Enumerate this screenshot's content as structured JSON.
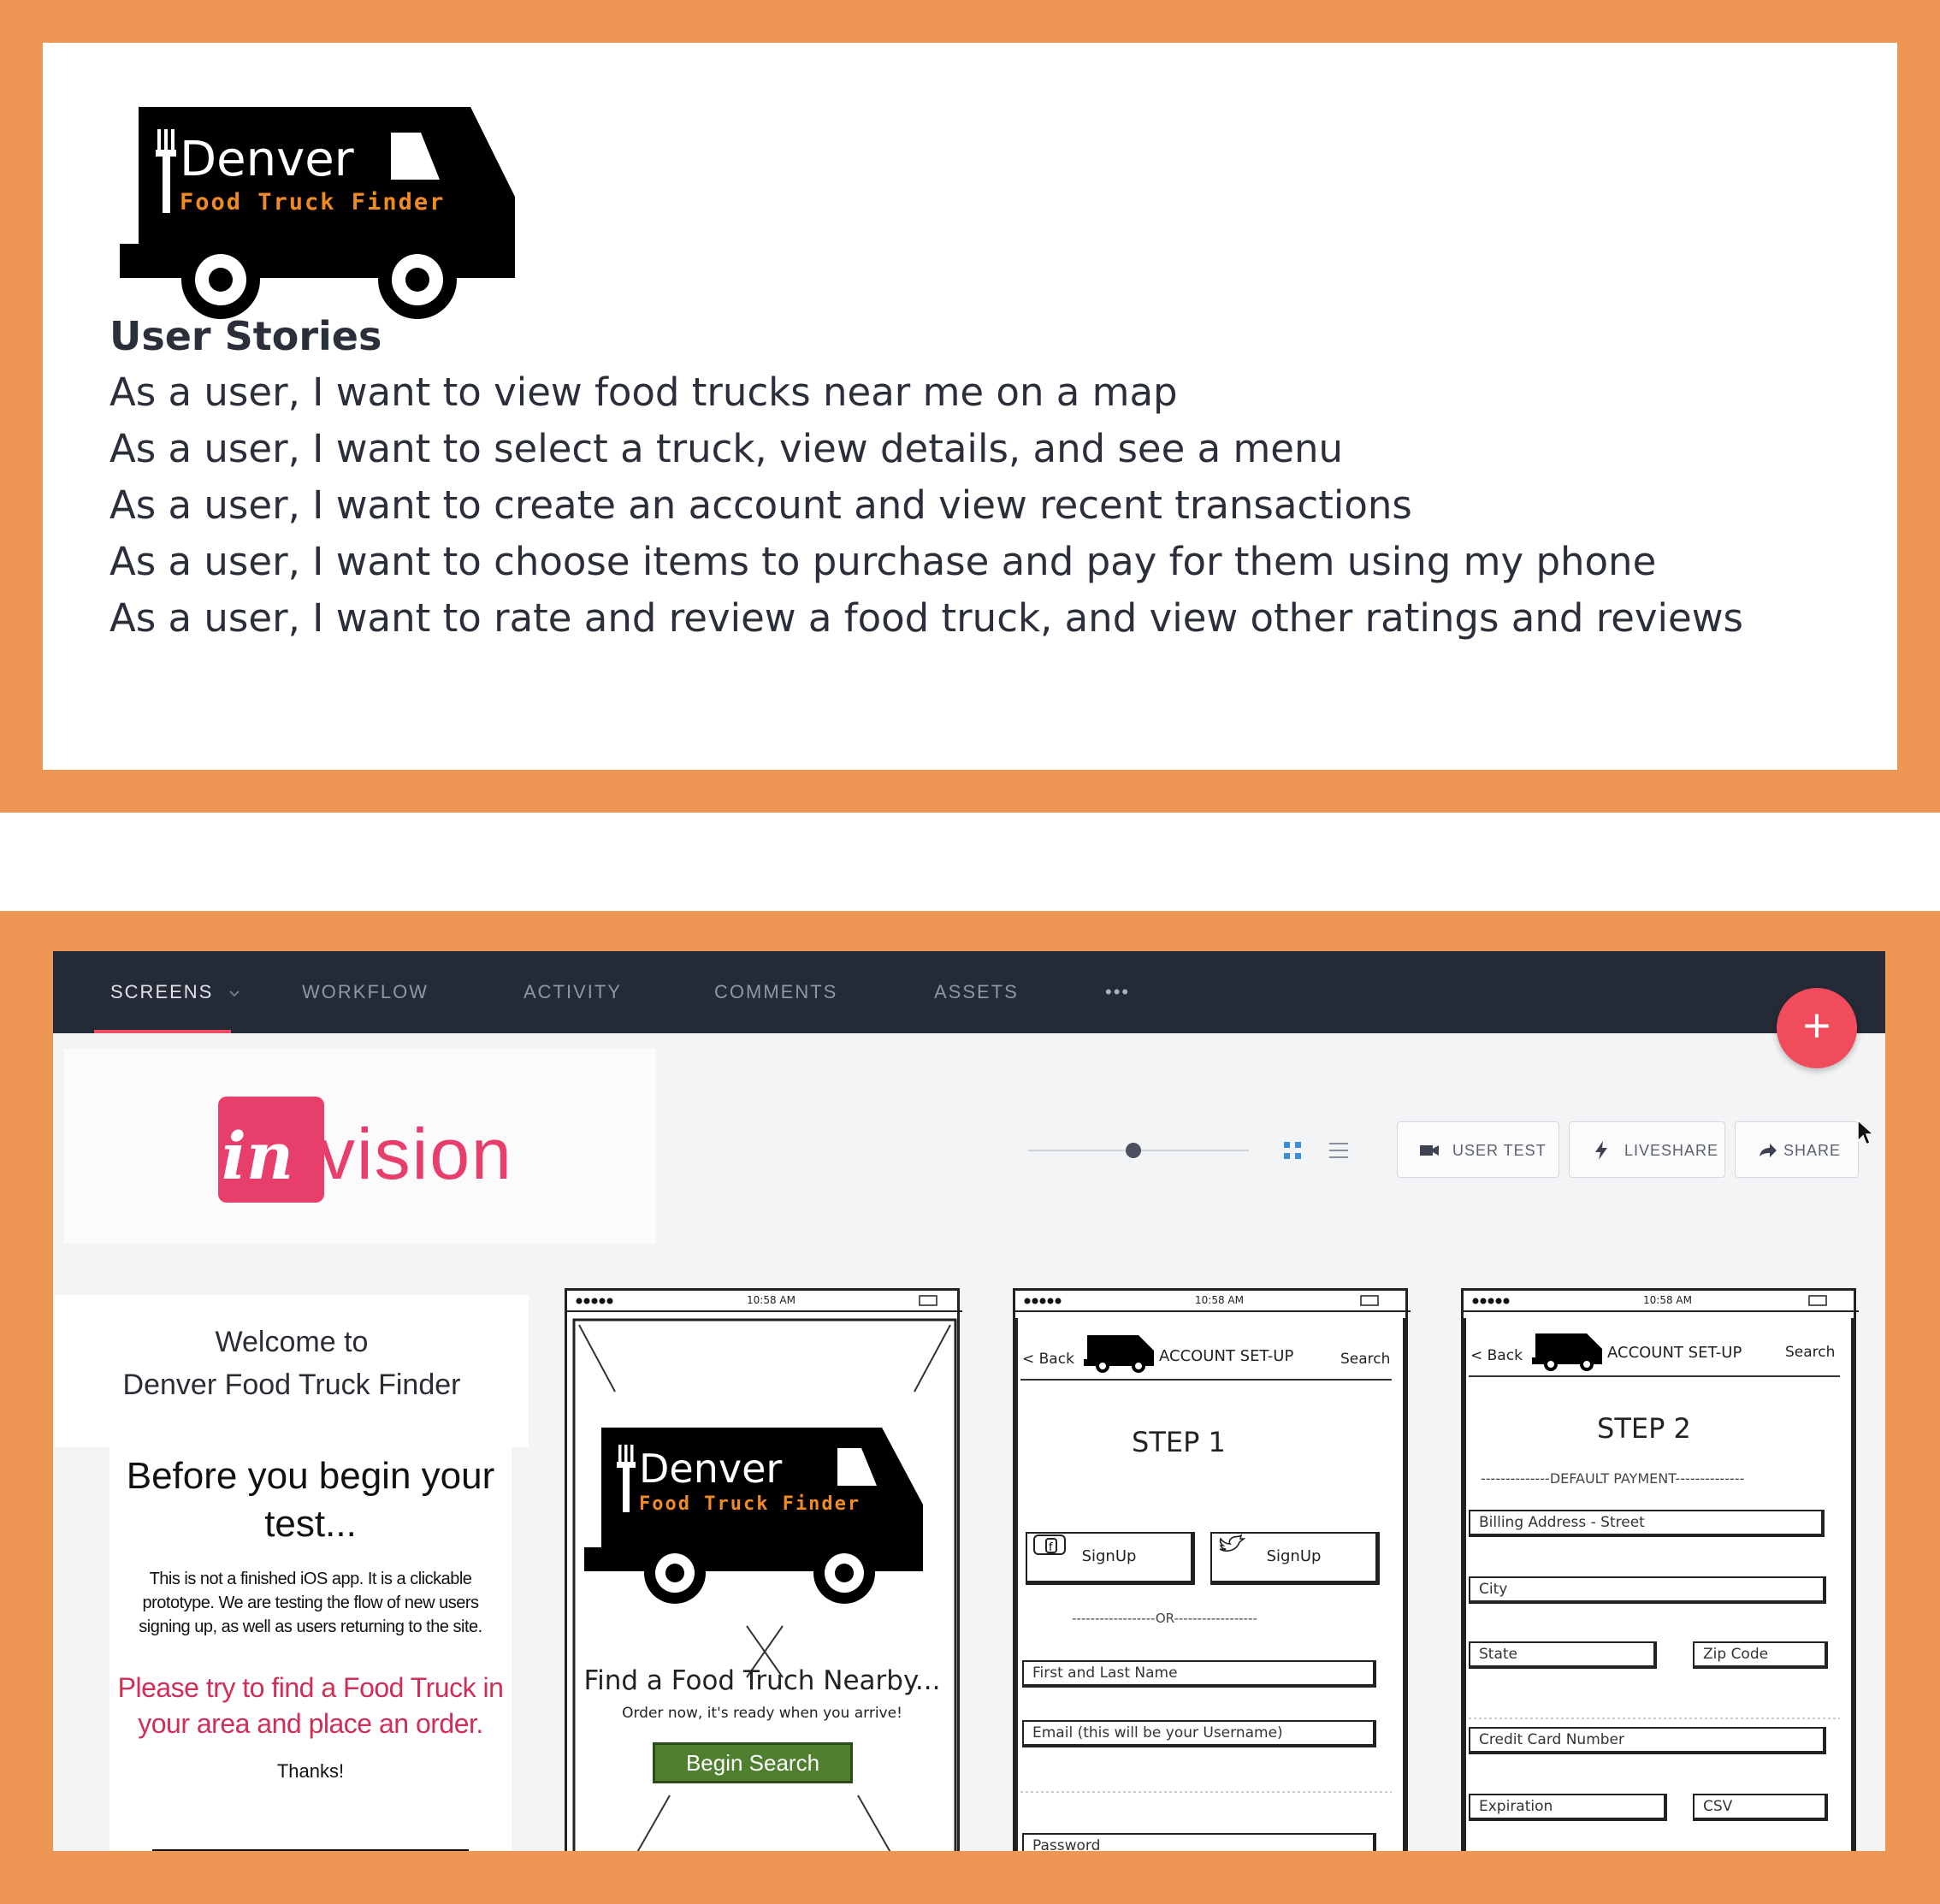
{
  "logo": {
    "line1": "Denver",
    "line2": "Food Truck Finder"
  },
  "user_stories": {
    "title": "User Stories",
    "items": [
      "As a user, I want to view food trucks near me on a map",
      "As a user, I want to select a truck, view details, and see a menu",
      "As a user, I want to create an account and view recent transactions",
      "As a user, I want to choose items to purchase and pay for them using my phone",
      "As a user, I want to rate and review a food truck, and view other ratings and reviews"
    ]
  },
  "nav": {
    "items": [
      "SCREENS",
      "WORKFLOW",
      "ACTIVITY",
      "COMMENTS",
      "ASSETS"
    ],
    "more": "•••",
    "active_index": 0
  },
  "fab_label": "+",
  "invision_logo": "invision",
  "toolbar": {
    "user_test": "USER TEST",
    "liveshare": "LIVESHARE",
    "share": "SHARE"
  },
  "welcome": {
    "line1": "Welcome to",
    "line2": "Denver Food Truck Finder",
    "title": "Before you begin your test...",
    "body": "This is not a finished iOS app. It is a clickable prototype. We are testing the flow of new users signing up, as well as users returning to the site.",
    "call_to_action": "Please try to find a Food Truck in your area and place an order.",
    "thanks": "Thanks!"
  },
  "phone_status": {
    "time": "10:58 AM"
  },
  "screen_home": {
    "headline": "Find a Food Truch Nearby...",
    "subtext": "Order now, it's ready when you arrive!",
    "button": "Begin Search"
  },
  "screen_step1": {
    "back": "< Back",
    "title": "ACCOUNT SET-UP",
    "search": "Search",
    "step": "STEP 1",
    "signup_facebook": "SignUp",
    "signup_twitter": "SignUp",
    "or_divider": "------------------OR------------------",
    "fields": [
      "First and Last Name",
      "Email  (this will be your Username)",
      "Password"
    ]
  },
  "screen_step2": {
    "back": "< Back",
    "title": "ACCOUNT SET-UP",
    "search": "Search",
    "step": "STEP 2",
    "section": "--------------DEFAULT PAYMENT--------------",
    "fields": [
      "Billing Address - Street",
      "City",
      "State",
      "Zip Code",
      "Credit Card Number",
      "Expiration",
      "CSV"
    ]
  },
  "colors": {
    "frame": "#ee9754",
    "nav_bg": "#252a37",
    "accent": "#f04c5b",
    "invision_pink": "#e83e6b",
    "begin_green": "#4f7f2f",
    "cta_red": "#cf2f57"
  }
}
